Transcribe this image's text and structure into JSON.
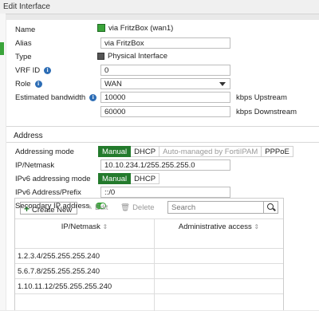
{
  "window": {
    "title": "Edit Interface"
  },
  "form": {
    "name": {
      "label": "Name",
      "value": "via FritzBox (wan1)"
    },
    "alias": {
      "label": "Alias",
      "value": "via FritzBox"
    },
    "type": {
      "label": "Type",
      "value": "Physical Interface"
    },
    "vrf_id": {
      "label": "VRF ID",
      "value": "0"
    },
    "role": {
      "label": "Role",
      "value": "WAN"
    },
    "bandwidth": {
      "label": "Estimated bandwidth",
      "upstream_value": "10000",
      "upstream_unit": "kbps Upstream",
      "downstream_value": "60000",
      "downstream_unit": "kbps Downstream"
    }
  },
  "address": {
    "section_title": "Address",
    "addressing_mode": {
      "label": "Addressing mode",
      "options": [
        "Manual",
        "DHCP",
        "Auto-managed by FortiIPAM",
        "PPPoE"
      ],
      "selected": "Manual"
    },
    "ip_netmask": {
      "label": "IP/Netmask",
      "value": "10.10.234.1/255.255.255.0"
    },
    "ipv6_mode": {
      "label": "IPv6 addressing mode",
      "options": [
        "Manual",
        "DHCP"
      ],
      "selected": "Manual"
    },
    "ipv6_prefix": {
      "label": "IPv6 Address/Prefix",
      "value": "::/0"
    },
    "secondary": {
      "label": "Secondary IP address",
      "enabled": true
    }
  },
  "secondary_table": {
    "toolbar": {
      "create": "Create New",
      "edit": "Edit",
      "delete": "Delete",
      "search_placeholder": "Search"
    },
    "columns": [
      "IP/Netmask",
      "Administrative access"
    ],
    "rows": [
      {
        "ip": "1.2.3.4/255.255.255.240",
        "access": ""
      },
      {
        "ip": "5.6.7.8/255.255.255.240",
        "access": ""
      },
      {
        "ip": "1.10.11.12/255.255.255.240",
        "access": ""
      }
    ]
  },
  "colors": {
    "accent_green": "#237a2c",
    "info_blue": "#2d6db5"
  }
}
